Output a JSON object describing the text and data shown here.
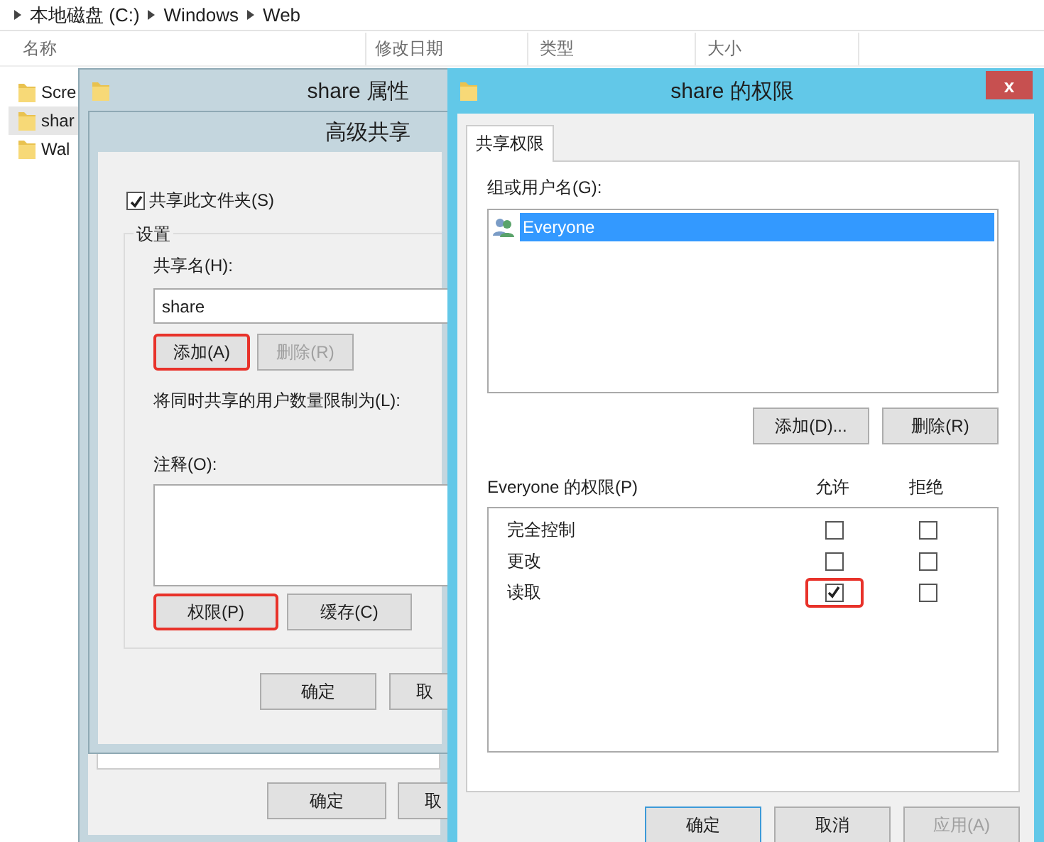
{
  "explorer": {
    "breadcrumb": [
      "本地磁盘 (C:)",
      "Windows",
      "Web"
    ],
    "columns": [
      "名称",
      "修改日期",
      "类型",
      "大小"
    ],
    "files": [
      {
        "name": "Scre",
        "selected": false
      },
      {
        "name": "shar",
        "selected": true
      },
      {
        "name": "Wal",
        "selected": false
      }
    ]
  },
  "properties_window": {
    "title": "share 属性",
    "buttons": [
      {
        "label": "确定",
        "cut": false
      },
      {
        "label": "取",
        "cut": true
      }
    ]
  },
  "advanced_sharing": {
    "title": "高级共享",
    "share_checkbox": {
      "label": "共享此文件夹(S)",
      "checked": true
    },
    "group_title": "设置",
    "share_name_label": "共享名(H):",
    "share_name": "share",
    "name_buttons": [
      {
        "label": "添加(A)",
        "disabled": false,
        "highlighted": true
      },
      {
        "label": "删除(R)",
        "disabled": true,
        "highlighted": false
      }
    ],
    "limit_label": "将同时共享的用户数量限制为(L):",
    "comment_label": "注释(O):",
    "option_buttons": [
      {
        "label": "权限(P)",
        "highlighted": true
      },
      {
        "label": "缓存(C)",
        "highlighted": false
      }
    ],
    "buttons": [
      {
        "label": "确定",
        "cut": false
      },
      {
        "label": "取",
        "cut": true
      }
    ]
  },
  "permissions_window": {
    "title": "share 的权限",
    "close": "x",
    "tabs": [
      {
        "label": "共享权限",
        "selected": true
      }
    ],
    "users_label": "组或用户名(G):",
    "users": [
      {
        "name": "Everyone",
        "selected": true
      }
    ],
    "user_buttons": [
      {
        "label": "添加(D)..."
      },
      {
        "label": "删除(R)"
      }
    ],
    "permissions_label": "Everyone 的权限(P)",
    "columns": [
      "允许",
      "拒绝"
    ],
    "permissions": [
      {
        "name": "完全控制",
        "allow": false,
        "deny": false,
        "allow_highlighted": false
      },
      {
        "name": "更改",
        "allow": false,
        "deny": false,
        "allow_highlighted": false
      },
      {
        "name": "读取",
        "allow": true,
        "deny": false,
        "allow_highlighted": true
      }
    ],
    "buttons": [
      {
        "label": "确定",
        "default": true,
        "disabled": false
      },
      {
        "label": "取消",
        "default": false,
        "disabled": false
      },
      {
        "label": "应用(A)",
        "default": false,
        "disabled": true
      }
    ]
  }
}
